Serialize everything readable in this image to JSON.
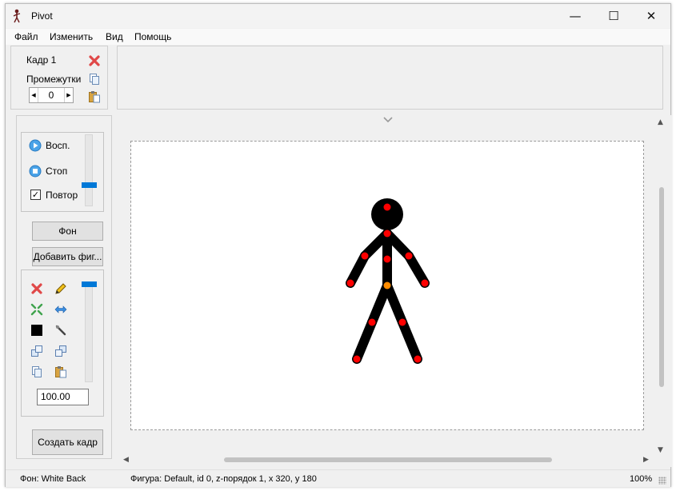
{
  "window": {
    "title": "Pivot"
  },
  "window_controls": {
    "minimize": "—",
    "maximize": "☐",
    "close": "✕"
  },
  "menu": [
    "Файл",
    "Изменить",
    "Вид",
    "Помощь"
  ],
  "frame_panel": {
    "frame_label": "Кадр 1",
    "intervals_label": "Промежутки",
    "intervals_value": "0"
  },
  "playback": {
    "play_label": "Восп.",
    "stop_label": "Стоп",
    "repeat_label": "Повтор",
    "repeat_checked": true,
    "speed_level": 0.4
  },
  "side_buttons": {
    "background": "Фон",
    "add_figure": "Добавить фиг...",
    "create_frame": "Создать кадр"
  },
  "tools": {
    "scale_value": "100.00",
    "slider_level": 1.0
  },
  "colors": {
    "accent": "#0078d7",
    "joint": "#ff0000",
    "joint_center": "#ff8c00",
    "figure": "#000000"
  },
  "status": {
    "background": "Фон: White Back",
    "figure": "Фигура: Default,  id 0,  z-порядок 1,  x 320, y 180",
    "zoom": "100%"
  }
}
